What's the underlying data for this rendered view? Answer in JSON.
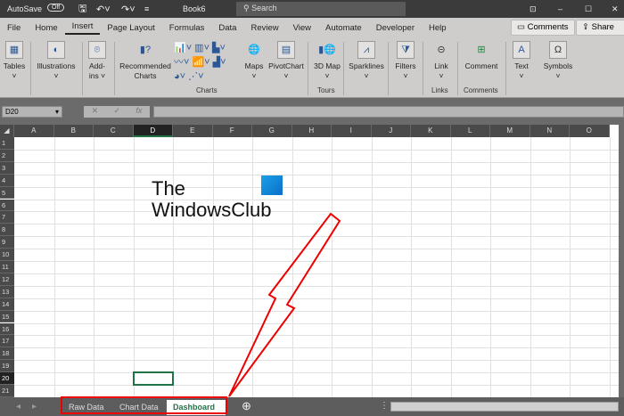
{
  "titlebar": {
    "autosave": "AutoSave",
    "toggle": "Off",
    "title": "Book6",
    "search": "Search"
  },
  "menu": {
    "tabs": [
      "File",
      "Home",
      "Insert",
      "Page Layout",
      "Formulas",
      "Data",
      "Review",
      "View",
      "Automate",
      "Developer",
      "Help"
    ],
    "active": "Insert",
    "comments": "Comments",
    "share": "Share"
  },
  "ribbon": {
    "buttons": [
      "Tables",
      "Illustrations",
      "Add-ins",
      "Recommended Charts",
      "Maps",
      "PivotChart",
      "3D Map",
      "Sparklines",
      "Filters",
      "Link",
      "Comment",
      "Text",
      "Symbols"
    ],
    "groups": [
      "Charts",
      "Tours",
      "Links",
      "Comments"
    ]
  },
  "formula_bar": {
    "name_box": "D20",
    "cancel": "✕",
    "enter": "✓",
    "fx": "fx",
    "value": ""
  },
  "sheet": {
    "columns": [
      "A",
      "B",
      "C",
      "D",
      "E",
      "F",
      "G",
      "H",
      "I",
      "J",
      "K",
      "L",
      "M",
      "N",
      "O"
    ],
    "rows": 21,
    "selected_cell": "D20"
  },
  "watermark": {
    "line1": "The",
    "line2": "WindowsClub"
  },
  "sheet_tabs": {
    "tabs": [
      "Raw Data",
      "Chart Data",
      "Dashboard"
    ],
    "active": "Dashboard"
  },
  "colors": {
    "excel_green": "#217346",
    "annotation_red": "#e00000"
  }
}
